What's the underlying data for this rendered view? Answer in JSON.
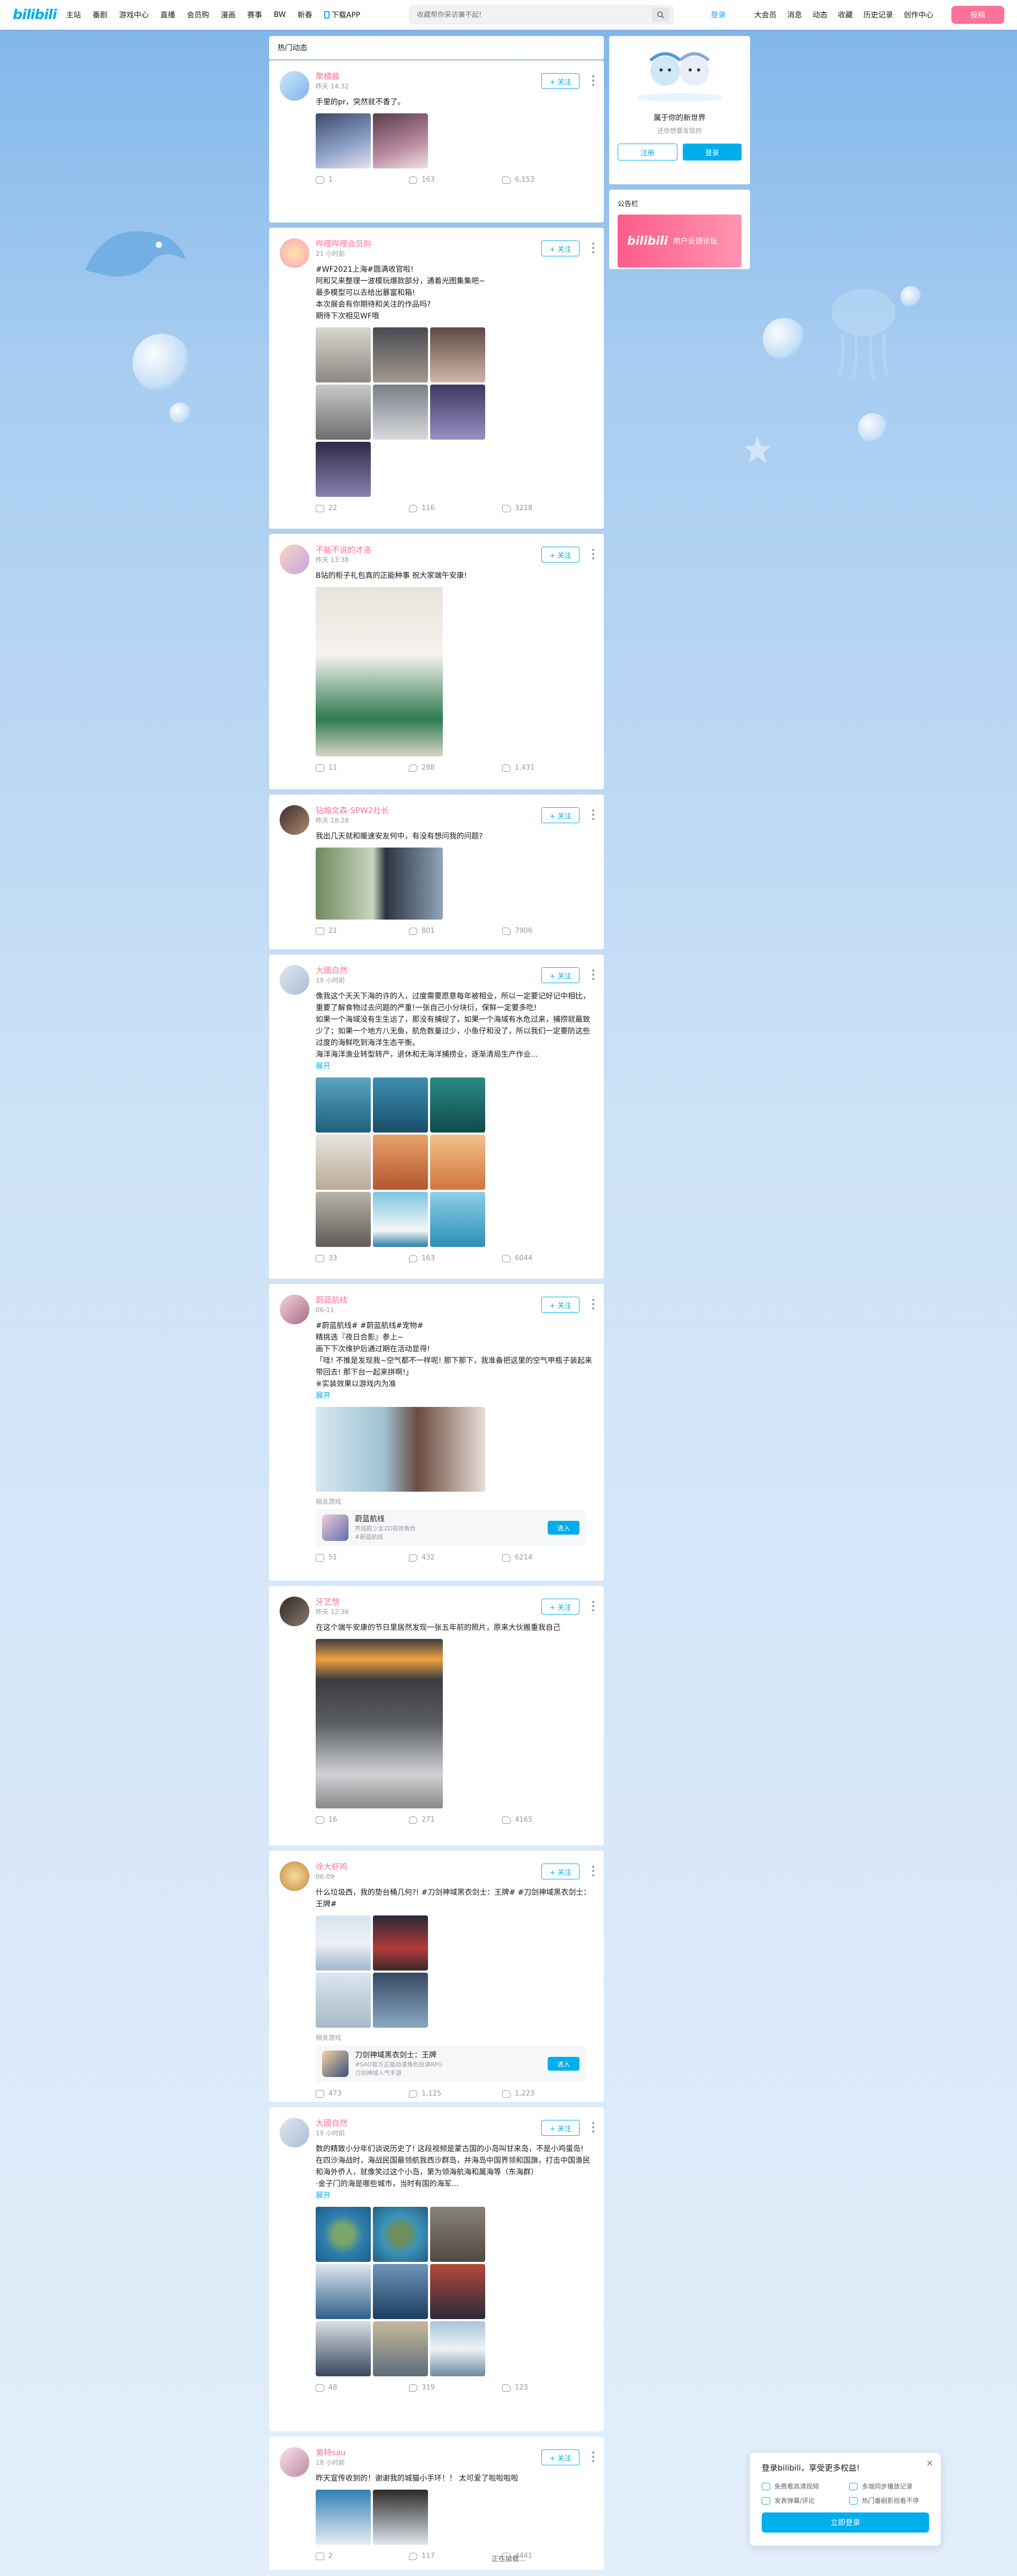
{
  "header": {
    "logo": "bilibili",
    "nav": [
      "主站",
      "番剧",
      "游戏中心",
      "直播",
      "会员购",
      "漫画",
      "赛事",
      "BW",
      "新春"
    ],
    "download": "下载APP",
    "search_placeholder": "收藏帮你采访兼不起!",
    "login": "登录",
    "right": [
      "大会员",
      "消息",
      "动态",
      "收藏",
      "历史记录",
      "创作中心"
    ],
    "upload": "投稿"
  },
  "feed": {
    "tab": "热门动态",
    "follow_label": "+ 关注",
    "expand_label": "展开",
    "game_label": "相关游戏",
    "enter_label": "进入",
    "posts": [
      {
        "user": "聚橘酱",
        "time": "昨天 14:32",
        "text": "手里的pr，突然就不香了。",
        "stats": [
          "1",
          "163",
          "6,153"
        ]
      },
      {
        "user": "哔哩哔哩会员购",
        "time": "21 小时前",
        "text": "#WF2021上海#圆满收官啦!\n阿和又来整理一波模玩爆款部分，通着光图集集吧~\n最多模型可以去给出暴富和箱!\n本次展会有你期待和关注的作品吗?\n期待下次相见WF哦",
        "stats": [
          "22",
          "116",
          "3218"
        ]
      },
      {
        "user": "不能不说的才洛",
        "time": "昨天 13:38",
        "text": "B站的柜子礼包真的正能种事 祝大家端午安康!",
        "stats": [
          "11",
          "288",
          "1,431"
        ]
      },
      {
        "user": "钻煽文森-SPW2社长",
        "time": "昨天 18:28",
        "text": "我出几天就和暖速安友何中，有没有想问我的问题?",
        "stats": [
          "21",
          "801",
          "7906"
        ]
      },
      {
        "user": "大國自然",
        "time": "19 小时前",
        "text": "像我这个天天下海的许的人，过度需要愿意每年被相业，所以一定要记好记中相比，重要了解食物过去问题的严重!一张自己小分块衍，保鲜一定要多吃!\n如果一个海域没有生生运了，那没有捕捉了，如果一个海域有水危过来，捕捞就最致少了；如果一个地方八无鱼，航危数量过少，小鱼仔和没了，所以我们一定要防这些过度的海鲜吃到海洋生态平衡。\n海洋海洋渔业转型转产，退休和无海洋捕捞业，逐渐清局生产作业...",
        "stats": [
          "33",
          "163",
          "6044"
        ]
      },
      {
        "user": "蔚蓝航线",
        "time": "06-11",
        "text": "#蔚蓝航线# #蔚蓝航线#宠物#\n精挑选『夜日合影』参上~\n画下下次维护后通过期在活动显得!\n「哇! 不推是发现我~空气都不一样呢! 那下那下，我准备把这里的空气甲瓶子装起来带回去! 那下台一起来拼啊!」\n※实装效果以游戏内为准",
        "game_name": "蔚蓝航线",
        "game_sub": "养成舰少女2D视效角色",
        "game_tag": "#蔚蓝航线",
        "stats": [
          "51",
          "432",
          "6214"
        ]
      },
      {
        "user": "牙艺想",
        "time": "昨天 12:36",
        "text": "在这个端午安康的节日里居然发现一张五年前的照片，原来大伙搬重我自己",
        "stats": [
          "16",
          "271",
          "4165"
        ]
      },
      {
        "user": "徐大虾鸡",
        "time": "06-09",
        "text": "什么垃圾西，我的垫台桶几何?! #刀剑神域黑衣剑士：王牌# #刀剑神域黑衣剑士：王牌#",
        "game_name": "刀剑神域黑衣剑士：王牌",
        "game_sub": "#SAO官方正版动漫角色扮演RPG",
        "game_tag": "刀剑神域人气手游",
        "stats": [
          "473",
          "1,125",
          "1,223"
        ]
      },
      {
        "user": "大國自然",
        "time": "19 小时前",
        "text": "数的精致小分年们谈说历史了! 这段视频是蒙古国的小岛叫甘来岛，不是小鸡蛋岛!\n在四沙海战时，海战民国最领航我西沙群岛，并海岛中国界领和国旗，打击中国渔民和海外侨人，就像笑过这个小岛，第为领海航海和属海等（东海群）\n·金子门的海是哪些城市，当时有国的海军...",
        "stats": [
          "48",
          "319",
          "123"
        ]
      },
      {
        "user": "黄特sau",
        "time": "18 小时前",
        "text": "昨天宣传收到的！谢谢我的城猫小手环！！ 太可爱了啦啦啦啦",
        "stats": [
          "2",
          "117",
          "4441"
        ]
      }
    ]
  },
  "sidebar": {
    "welcome_title": "属于你的新世界",
    "welcome_sub": "还你想要发现的",
    "register": "注册",
    "login": "登录",
    "notice_title": "公告栏",
    "banner_logo": "bilibili",
    "banner_text": "用户反馈论坛"
  },
  "popup": {
    "title": "登录bilibili，享受更多权益!",
    "items": [
      "免费看高清视频",
      "多端同步播放记录",
      "发表弹幕/评论",
      "热门番剧影视看不停"
    ],
    "button": "立即登录",
    "close": "×"
  },
  "footer": "正在加载..."
}
